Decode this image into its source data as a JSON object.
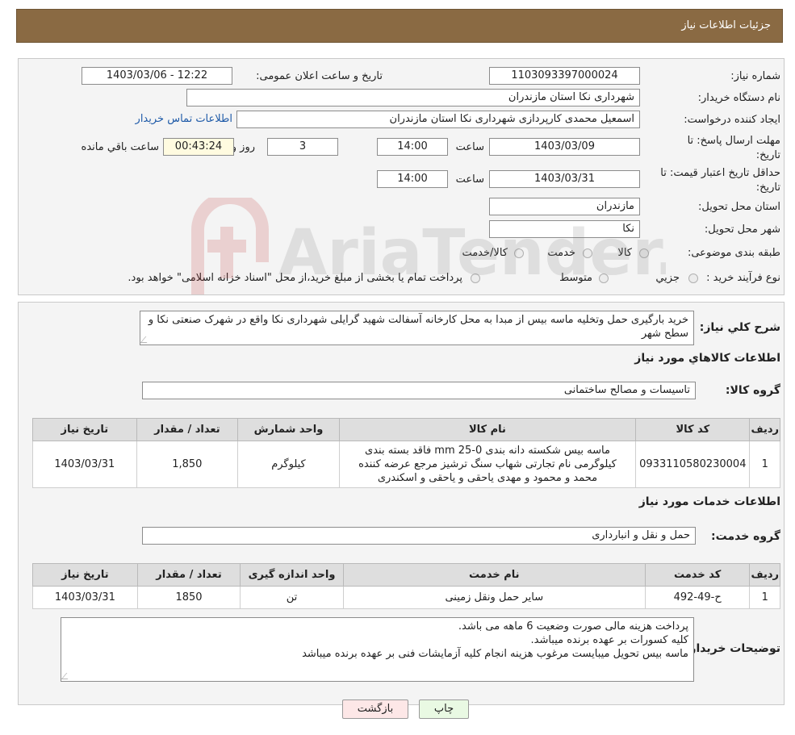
{
  "header": {
    "title": "جزئیات اطلاعات نیاز"
  },
  "info": {
    "need_number_label": "شماره نیاز:",
    "need_number": "1103093397000024",
    "announce_label": "تاریخ و ساعت اعلان عمومی:",
    "announce_value": "1403/03/06 - 12:22",
    "buyer_org_label": "نام دستگاه خریدار:",
    "buyer_org": "شهرداری نکا استان مازندران",
    "requester_label": "ایجاد کننده درخواست:",
    "requester": "اسمعیل محمدی کارپردازی شهرداری نکا استان مازندران",
    "contact_link": "اطلاعات تماس خریدار",
    "reply_deadline_label": "مهلت ارسال پاسخ: تا تاریخ:",
    "reply_date": "1403/03/09",
    "time_label": "ساعت",
    "reply_time": "14:00",
    "days_value": "3",
    "days_label": "روز و",
    "remaining_time": "00:43:24",
    "remaining_label": "ساعت باقي مانده",
    "price_validity_label": "حداقل تاریخ اعتبار قیمت: تا تاریخ:",
    "price_date": "1403/03/31",
    "price_time": "14:00",
    "province_label": "استان محل تحویل:",
    "province": "مازندران",
    "city_label": "شهر محل تحویل:",
    "city": "نکا",
    "category_label": "طبقه بندی موضوعی:",
    "category_options": [
      "کالا",
      "خدمت",
      "کالا/خدمت"
    ],
    "process_label": "نوع فرآیند خرید :",
    "process_options": [
      "جزيي",
      "متوسط"
    ],
    "process_note": "پرداخت تمام یا بخشی از مبلغ خرید،از محل \"اسناد خزانه اسلامی\" خواهد بود."
  },
  "description": {
    "label": "شرح کلي نياز:",
    "text": "خرید بارگیری حمل وتخلیه ماسه بیس از مبدا به محل کارخانه آسفالت شهید گرایلی شهرداری نکا واقع در شهرک صنعتی نکا و سطح شهر"
  },
  "goods": {
    "section_title": "اطلاعات كالاهاي مورد نياز",
    "group_label": "گروه کالا:",
    "group_value": "تاسیسات و مصالح ساختمانی",
    "columns": [
      "رديف",
      "کد کالا",
      "نام کالا",
      "واحد شمارش",
      "تعداد / مقدار",
      "تاريخ نياز"
    ],
    "rows": [
      {
        "row": "1",
        "code": "0933110580230004",
        "name": "ماسه بیس شکسته دانه بندی mm 25-0 فاقد بسته بندی کیلوگرمی نام تجارتی شهاب سنگ ترشیز مرجع عرضه کننده محمد و محمود و مهدی یاحقی و یاحقی و اسکندری",
        "unit": "کیلوگرم",
        "qty": "1,850",
        "date": "1403/03/31"
      }
    ]
  },
  "services": {
    "section_title": "اطلاعات خدمات مورد نياز",
    "group_label": "گروه خدمت:",
    "group_value": "حمل و نقل و انبارداری",
    "columns": [
      "رديف",
      "کد خدمت",
      "نام خدمت",
      "واحد اندازه گیری",
      "تعداد / مقدار",
      "تاريخ نياز"
    ],
    "rows": [
      {
        "row": "1",
        "code": "ح-49-492",
        "name": "سایر حمل ونقل زمینی",
        "unit": "تن",
        "qty": "1850",
        "date": "1403/03/31"
      }
    ]
  },
  "buyer_notes": {
    "label": "توضیحات خریدار:",
    "lines": [
      "پرداخت هزینه مالی صورت وضعیت 6 ماهه می باشد.",
      "کلیه کسورات بر عهده برنده میباشد.",
      "ماسه بیس تحویل میبایست مرغوب هزینه انجام کلیه آزمایشات فنی بر عهده برنده میباشد"
    ]
  },
  "buttons": {
    "print": "چاپ",
    "back": "بازگشت"
  },
  "watermark": {
    "text": "AriaTender.neT"
  }
}
